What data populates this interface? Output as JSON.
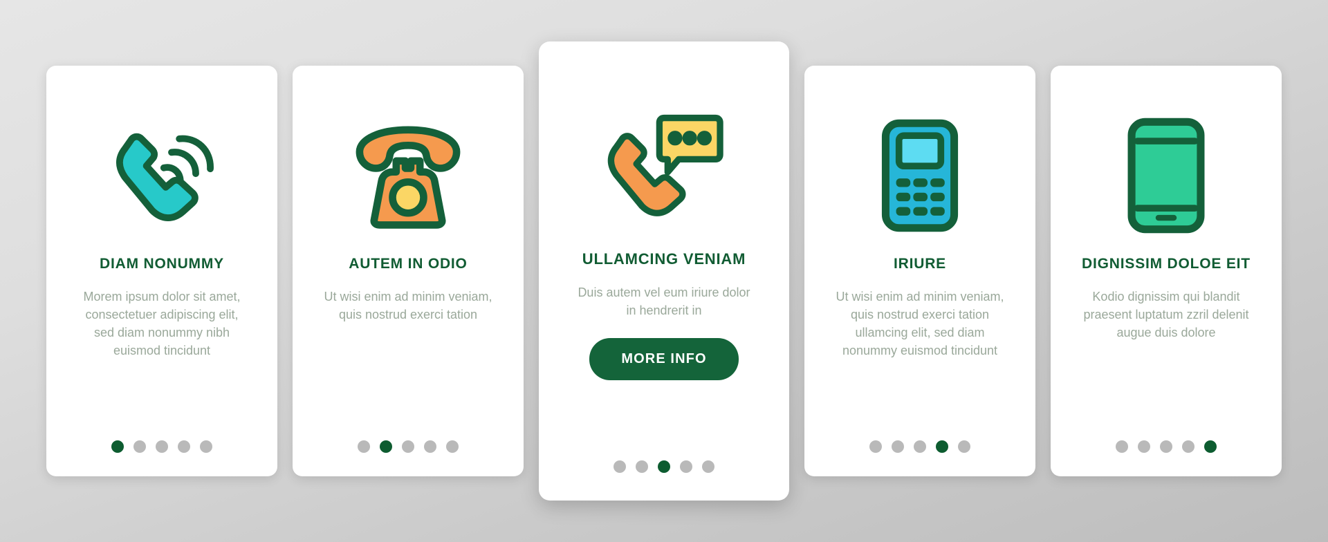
{
  "theme": {
    "background_top": "#e6e6e6",
    "background_bottom": "#bdbdbd",
    "card_background": "#ffffff",
    "title_color": "#115c33",
    "body_color": "#9aa89a",
    "dot_inactive": "#b9b9b9",
    "dot_active": "#0d5c30",
    "button_background": "#14643a",
    "button_text": "#ffffff",
    "outline_color": "#14603a",
    "cyan": "#27c9c9",
    "cyan_light": "#5ddcf2",
    "cyan_phone": "#26b6d8",
    "orange": "#f59a4e",
    "yellow": "#fbd665",
    "green_screen": "#2ecc96"
  },
  "cards": [
    {
      "icon": "phone-handset-ringing-icon",
      "title": "DIAM NONUMMY",
      "body": "Morem ipsum dolor sit amet, consectetuer adipiscing elit, sed diam nonummy nibh euismod tincidunt",
      "dots": {
        "count": 5,
        "active_index": 0
      },
      "featured": false,
      "button_label": null
    },
    {
      "icon": "retro-rotary-phone-icon",
      "title": "AUTEM IN ODIO",
      "body": "Ut wisi enim ad minim veniam, quis nostrud exerci tation",
      "dots": {
        "count": 5,
        "active_index": 1
      },
      "featured": false,
      "button_label": null
    },
    {
      "icon": "phone-chat-bubble-icon",
      "title": "ULLAMCING VENIAM",
      "body": "Duis autem vel eum iriure dolor in hendrerit in",
      "dots": {
        "count": 5,
        "active_index": 2
      },
      "featured": true,
      "button_label": "MORE INFO"
    },
    {
      "icon": "feature-phone-keypad-icon",
      "title": "IRIURE",
      "body": "Ut wisi enim ad minim veniam, quis nostrud exerci tation ullamcing elit, sed diam nonummy euismod tincidunt",
      "dots": {
        "count": 5,
        "active_index": 3
      },
      "featured": false,
      "button_label": null
    },
    {
      "icon": "smartphone-icon",
      "title": "DIGNISSIM DOLOE EIT",
      "body": "Kodio dignissim qui blandit praesent luptatum zzril delenit augue duis dolore",
      "dots": {
        "count": 5,
        "active_index": 4
      },
      "featured": false,
      "button_label": null
    }
  ]
}
